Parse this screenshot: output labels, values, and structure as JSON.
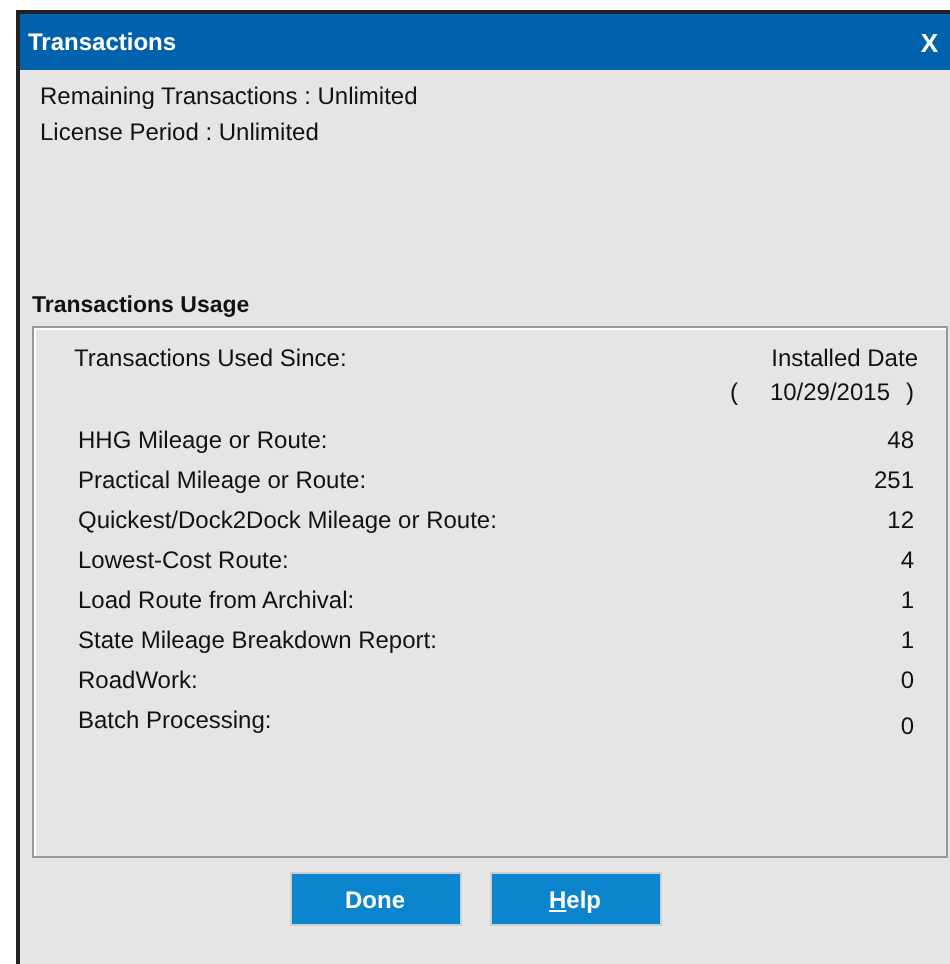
{
  "window": {
    "title": "Transactions",
    "close": "X"
  },
  "info": [
    "Remaining Transactions : Unlimited",
    "License Period : Unlimited"
  ],
  "usage": {
    "title": "Transactions Usage",
    "since_label": "Transactions Used Since:",
    "since_value": "Installed Date",
    "date_open": "(",
    "date": "10/29/2015",
    "date_close": ")",
    "rows": [
      {
        "label": "HHG Mileage or Route:",
        "value": "48"
      },
      {
        "label": "Practical Mileage or Route:",
        "value": "251"
      },
      {
        "label": "Quickest/Dock2Dock Mileage or Route:",
        "value": "12"
      },
      {
        "label": "Lowest-Cost Route:",
        "value": "4"
      },
      {
        "label": "Load Route from Archival:",
        "value": "1"
      },
      {
        "label": "State Mileage Breakdown Report:",
        "value": "1"
      },
      {
        "label": "RoadWork:",
        "value": "0"
      },
      {
        "label": "Batch Processing:",
        "value": "0"
      }
    ]
  },
  "buttons": [
    {
      "label": "Done",
      "mnemonic": false
    },
    {
      "label": "Help",
      "mnemonic": true
    }
  ]
}
